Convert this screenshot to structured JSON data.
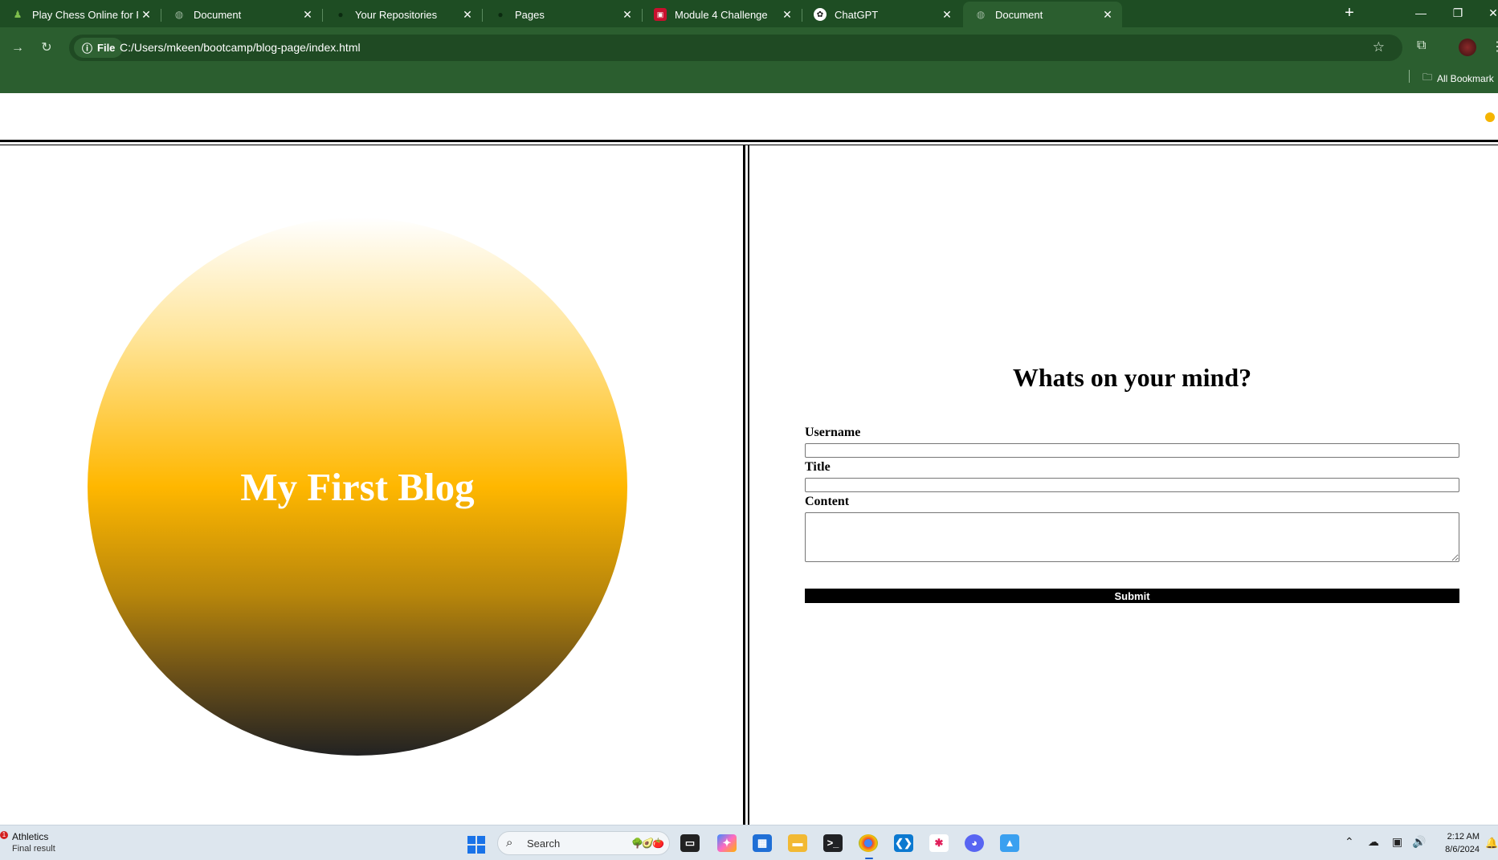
{
  "browser": {
    "tabs": [
      {
        "title": "Play Chess Online for Free with",
        "icon": "chess-pawn-icon",
        "active": false
      },
      {
        "title": "Document",
        "icon": "globe-icon",
        "active": false
      },
      {
        "title": "Your Repositories",
        "icon": "github-icon",
        "active": false
      },
      {
        "title": "Pages",
        "icon": "github-icon",
        "active": false
      },
      {
        "title": "Module 4 Challenge",
        "icon": "canvas-icon",
        "active": false
      },
      {
        "title": "ChatGPT",
        "icon": "chatgpt-icon",
        "active": false
      },
      {
        "title": "Document",
        "icon": "globe-icon",
        "active": true
      }
    ],
    "close_glyph": "✕",
    "new_tab_glyph": "+",
    "address": {
      "scheme_chip": "File",
      "url": "C:/Users/mkeen/bootcamp/blog-page/index.html"
    },
    "bookmarks_label": "All Bookmark"
  },
  "page": {
    "blog_title": "My First Blog",
    "form": {
      "heading": "Whats on your mind?",
      "username_label": "Username",
      "title_label": "Title",
      "content_label": "Content",
      "username_value": "",
      "title_value": "",
      "content_value": "",
      "submit_label": "Submit"
    },
    "colors": {
      "gradient_top": "#ffffff",
      "gradient_mid": "#ffb700",
      "gradient_bottom": "#222222",
      "chrome_green": "#2b5e2f"
    }
  },
  "taskbar": {
    "widget_title": "Athletics",
    "widget_subtitle": "Final result",
    "widget_badge": "1",
    "search_label": "Search",
    "time": "2:12 AM",
    "date": "8/6/2024",
    "apps": [
      "file-explorer-icon",
      "copilot-icon",
      "store-icon",
      "folder-icon",
      "terminal-icon",
      "chrome-icon",
      "vscode-icon",
      "slack-icon",
      "discord-icon",
      "photos-icon"
    ]
  }
}
